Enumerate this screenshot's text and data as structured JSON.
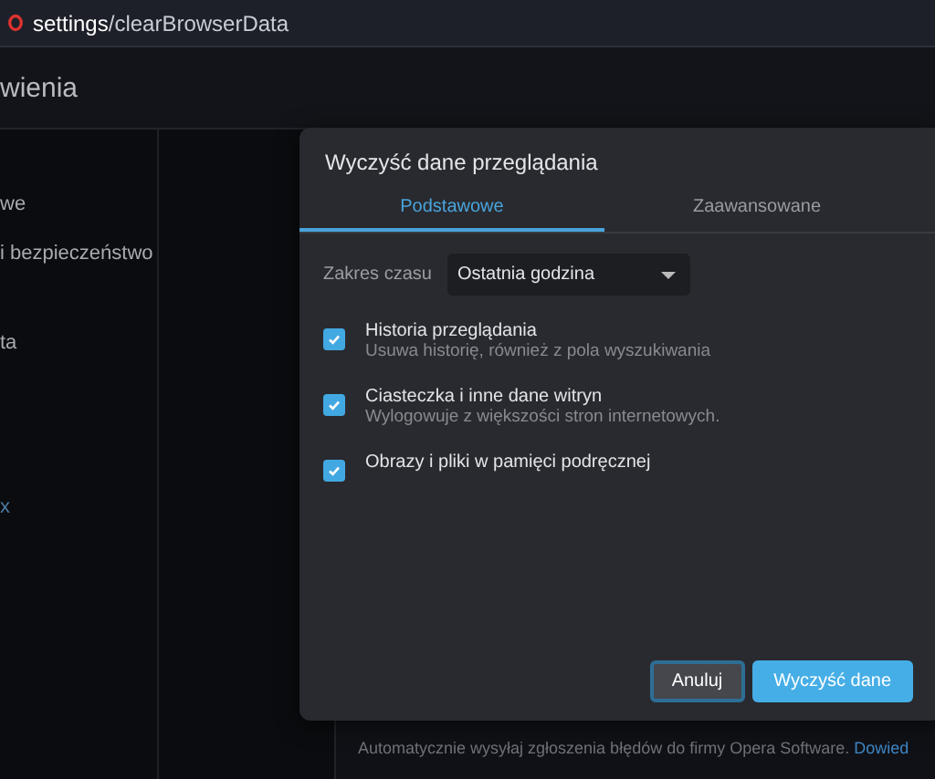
{
  "address_bar": {
    "url_host": "settings",
    "url_path": "/clearBrowserData"
  },
  "header": {
    "title": "wienia"
  },
  "sidebar": {
    "items": [
      {
        "label": "we",
        "kind": "text"
      },
      {
        "label": "i bezpieczeństwo",
        "kind": "text"
      },
      {
        "label": "ta",
        "kind": "text"
      },
      {
        "label": "x",
        "kind": "link"
      }
    ]
  },
  "background": {
    "text": "Automatycznie wysyłaj zgłoszenia błędów do firmy Opera Software.",
    "link": "Dowied"
  },
  "dialog": {
    "title": "Wyczyść dane przeglądania",
    "tabs": [
      {
        "label": "Podstawowe",
        "selected": true
      },
      {
        "label": "Zaawansowane",
        "selected": false
      }
    ],
    "time_range": {
      "label": "Zakres czasu",
      "value": "Ostatnia godzina"
    },
    "options": [
      {
        "label": "Historia przeglądania",
        "description": "Usuwa historię, również z pola wyszukiwania",
        "checked": true
      },
      {
        "label": "Ciasteczka i inne dane witryn",
        "description": "Wylogowuje z większości stron internetowych.",
        "checked": true
      },
      {
        "label": "Obrazy i pliki w pamięci podręcznej",
        "checked": true
      }
    ],
    "buttons": [
      {
        "label": "Anuluj",
        "kind": "secondary"
      },
      {
        "label": "Wyczyść dane",
        "kind": "primary"
      }
    ]
  }
}
